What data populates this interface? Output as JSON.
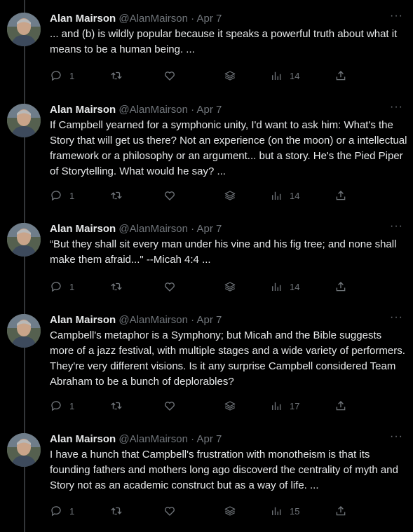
{
  "author": {
    "name": "Alan Mairson",
    "handle": "@AlanMairson",
    "separator": "·"
  },
  "more_label": "···",
  "tweets": [
    {
      "time": "Apr 7",
      "text": "... and (b) is wildly popular because it speaks a powerful truth about what it means to be a human being. ...",
      "replies": "1",
      "views": "14"
    },
    {
      "time": "Apr 7",
      "text": "If Campbell yearned for a symphonic unity, I'd want to ask him: What's the Story that will get us there? Not an experience (on the moon) or a intellectual framework or a philosophy or an argument... but a story. He's the Pied Piper of Storytelling. What would he say? ...",
      "replies": "1",
      "views": "14"
    },
    {
      "time": "Apr 7",
      "text": "“But they shall sit every man under his vine and  his fig tree; and none shall make them afraid...\" --Micah 4:4 ...",
      "replies": "1",
      "views": "14"
    },
    {
      "time": "Apr 7",
      "text": "Campbell's metaphor is a Symphony; but Micah and the Bible suggests more of a jazz festival, with multiple stages and a wide variety of performers. They're very different visions. Is it any surprise Campbell considered Team Abraham to be a bunch of deplorables?",
      "replies": "1",
      "views": "17"
    },
    {
      "time": "Apr 7",
      "text": "I have a hunch that Campbell's frustration with monotheism is that its founding fathers and mothers long ago discoverd the centrality of myth and Story not as an academic construct but as a way of life. ...",
      "replies": "1",
      "views": "15"
    }
  ],
  "icons": [
    "reply-icon",
    "retweet-icon",
    "like-icon",
    "stack-icon",
    "views-icon",
    "share-icon"
  ],
  "colors": {
    "background": "#000000",
    "text": "#e7e9ea",
    "muted": "#71767b",
    "line": "#333639"
  }
}
